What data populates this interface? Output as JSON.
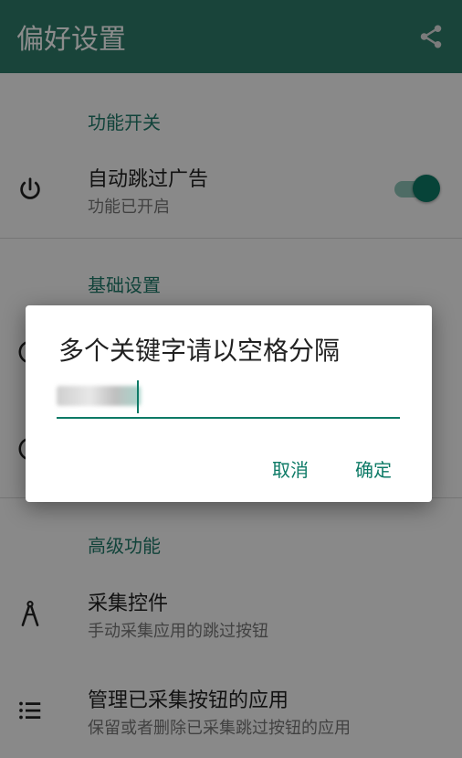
{
  "appbar": {
    "title": "偏好设置",
    "share_icon": "share-icon"
  },
  "sections": {
    "function_switch": {
      "header": "功能开关",
      "auto_skip": {
        "title": "自动跳过广告",
        "summary": "功能已开启",
        "icon": "power-icon",
        "enabled": true
      }
    },
    "basic": {
      "header": "基础设置"
    },
    "advanced": {
      "header": "高级功能",
      "collect": {
        "title": "采集控件",
        "summary": "手动采集应用的跳过按钮",
        "icon": "compass-icon"
      },
      "manage": {
        "title": "管理已采集按钮的应用",
        "summary": "保留或者删除已采集跳过按钮的应用",
        "icon": "list-icon"
      }
    }
  },
  "dialog": {
    "title": "多个关键字请以空格分隔",
    "cancel_label": "取消",
    "ok_label": "确定"
  },
  "colors": {
    "accent": "#0d7a66",
    "appbar": "#2e7d6b"
  }
}
